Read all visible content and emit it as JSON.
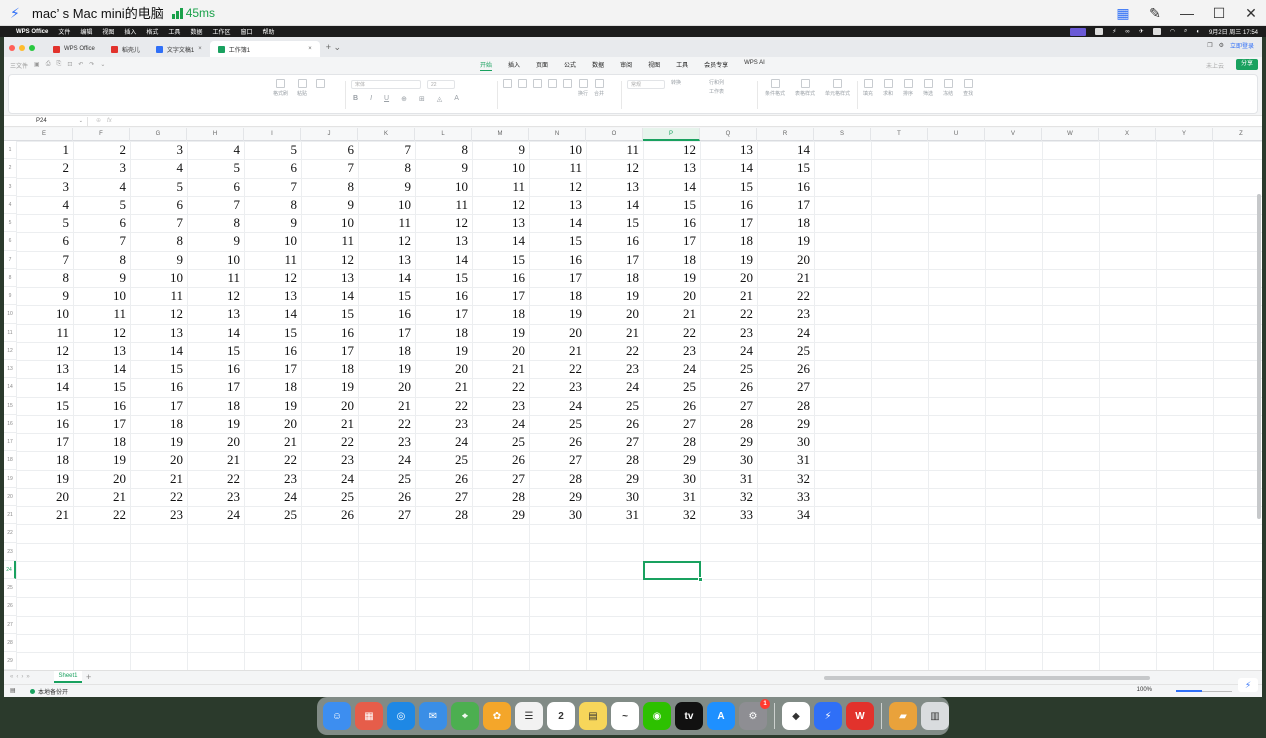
{
  "remote_desktop": {
    "title": "mac’ s Mac mini的电脑",
    "ping": "45ms"
  },
  "mac_menubar": {
    "app_name": "WPS Office",
    "items": [
      "文件",
      "编辑",
      "视图",
      "插入",
      "格式",
      "工具",
      "数据",
      "工作区",
      "窗口",
      "帮助"
    ],
    "clock": "9月2日 周三 17:54"
  },
  "wps": {
    "tabs": [
      {
        "label": "WPS Office",
        "color": "#e2322c"
      },
      {
        "label": "稻壳儿",
        "color": "#e2322c"
      },
      {
        "label": "文字文稿1",
        "color": "#2f6ff7"
      },
      {
        "label": "工作簿1",
        "color": "#19a15f",
        "active": true
      }
    ],
    "login_label": "立即登录",
    "quick_label": "三文件",
    "ribbon_tabs": [
      "开始",
      "插入",
      "页面",
      "公式",
      "数据",
      "审阅",
      "视图",
      "工具",
      "会员专享",
      "WPS AI"
    ],
    "active_ribbon_tab": "开始",
    "unsaved_label": "未上云",
    "share_label": "分享",
    "ribbon_items": {
      "clipboard": [
        "格式刷",
        "粘贴",
        ""
      ],
      "font_name": "宋体",
      "font_size": "22",
      "align": [
        "换行",
        "合并"
      ],
      "number_format": "常规",
      "tools": [
        "转换",
        "行和列",
        "工作表",
        "条件格式",
        "表格样式",
        "单元格样式",
        "填充",
        "求和",
        "排序",
        "筛选",
        "冻结",
        "查找"
      ]
    },
    "name_box": "P24",
    "fx_label": "fx"
  },
  "sheet": {
    "columns": [
      "E",
      "F",
      "G",
      "H",
      "I",
      "J",
      "K",
      "L",
      "M",
      "N",
      "O",
      "P",
      "Q",
      "R",
      "S",
      "T",
      "U",
      "V",
      "W",
      "X",
      "Y",
      "Z"
    ],
    "selected_column": "P",
    "row_numbers": [
      "1",
      "2",
      "3",
      "4",
      "5",
      "6",
      "7",
      "8",
      "9",
      "10",
      "11",
      "12",
      "13",
      "14",
      "15",
      "16",
      "17",
      "18",
      "19",
      "20",
      "21",
      "22",
      "23",
      "24",
      "25",
      "26",
      "27",
      "28",
      "29"
    ],
    "selected_row": "24",
    "data_rows": [
      [
        1,
        2,
        3,
        4,
        5,
        6,
        7,
        8,
        9,
        10,
        11,
        12,
        13,
        14
      ],
      [
        2,
        3,
        4,
        5,
        6,
        7,
        8,
        9,
        10,
        11,
        12,
        13,
        14,
        15
      ],
      [
        3,
        4,
        5,
        6,
        7,
        8,
        9,
        10,
        11,
        12,
        13,
        14,
        15,
        16
      ],
      [
        4,
        5,
        6,
        7,
        8,
        9,
        10,
        11,
        12,
        13,
        14,
        15,
        16,
        17
      ],
      [
        5,
        6,
        7,
        8,
        9,
        10,
        11,
        12,
        13,
        14,
        15,
        16,
        17,
        18
      ],
      [
        6,
        7,
        8,
        9,
        10,
        11,
        12,
        13,
        14,
        15,
        16,
        17,
        18,
        19
      ],
      [
        7,
        8,
        9,
        10,
        11,
        12,
        13,
        14,
        15,
        16,
        17,
        18,
        19,
        20
      ],
      [
        8,
        9,
        10,
        11,
        12,
        13,
        14,
        15,
        16,
        17,
        18,
        19,
        20,
        21
      ],
      [
        9,
        10,
        11,
        12,
        13,
        14,
        15,
        16,
        17,
        18,
        19,
        20,
        21,
        22
      ],
      [
        10,
        11,
        12,
        13,
        14,
        15,
        16,
        17,
        18,
        19,
        20,
        21,
        22,
        23
      ],
      [
        11,
        12,
        13,
        14,
        15,
        16,
        17,
        18,
        19,
        20,
        21,
        22,
        23,
        24
      ],
      [
        12,
        13,
        14,
        15,
        16,
        17,
        18,
        19,
        20,
        21,
        22,
        23,
        24,
        25
      ],
      [
        13,
        14,
        15,
        16,
        17,
        18,
        19,
        20,
        21,
        22,
        23,
        24,
        25,
        26
      ],
      [
        14,
        15,
        16,
        17,
        18,
        19,
        20,
        21,
        22,
        23,
        24,
        25,
        26,
        27
      ],
      [
        15,
        16,
        17,
        18,
        19,
        20,
        21,
        22,
        23,
        24,
        25,
        26,
        27,
        28
      ],
      [
        16,
        17,
        18,
        19,
        20,
        21,
        22,
        23,
        24,
        25,
        26,
        27,
        28,
        29
      ],
      [
        17,
        18,
        19,
        20,
        21,
        22,
        23,
        24,
        25,
        26,
        27,
        28,
        29,
        30
      ],
      [
        18,
        19,
        20,
        21,
        22,
        23,
        24,
        25,
        26,
        27,
        28,
        29,
        30,
        31
      ],
      [
        19,
        20,
        21,
        22,
        23,
        24,
        25,
        26,
        27,
        28,
        29,
        30,
        31,
        32
      ],
      [
        20,
        21,
        22,
        23,
        24,
        25,
        26,
        27,
        28,
        29,
        30,
        31,
        32,
        33
      ],
      [
        21,
        22,
        23,
        24,
        25,
        26,
        27,
        28,
        29,
        30,
        31,
        32,
        33,
        34
      ]
    ],
    "sheet_tab": "Sheet1",
    "backup_status": "本地备份开",
    "zoom": "100%"
  },
  "dock": {
    "apps": [
      {
        "name": "finder-icon",
        "color": "#3d8ef0",
        "glyph": "☺"
      },
      {
        "name": "launchpad-icon",
        "color": "#e65d4a",
        "glyph": "▦"
      },
      {
        "name": "safari-icon",
        "color": "#1e88e5",
        "glyph": "◎"
      },
      {
        "name": "mail-icon",
        "color": "#3a8ee6",
        "glyph": "✉"
      },
      {
        "name": "maps-icon",
        "color": "#4caf50",
        "glyph": "⌖"
      },
      {
        "name": "photos-icon",
        "color": "#f4a62a",
        "glyph": "✿"
      },
      {
        "name": "reminders-icon",
        "color": "#f2f2f2",
        "glyph": "☰"
      },
      {
        "name": "calendar-icon",
        "color": "#ffffff",
        "glyph": "2"
      },
      {
        "name": "notes-icon",
        "color": "#f7d65a",
        "glyph": "▤"
      },
      {
        "name": "freeform-icon",
        "color": "#ffffff",
        "glyph": "~"
      },
      {
        "name": "wechat-icon",
        "color": "#2dc100",
        "glyph": "◉"
      },
      {
        "name": "appletv-icon",
        "color": "#111111",
        "glyph": "tv"
      },
      {
        "name": "appstore-icon",
        "color": "#1e90ff",
        "glyph": "A"
      },
      {
        "name": "settings-icon",
        "color": "#8e8e93",
        "glyph": "⚙",
        "badge": "1"
      },
      {
        "name": "baidu-netdisk-icon",
        "color": "#ffffff",
        "glyph": "◆"
      },
      {
        "name": "todesk-icon",
        "color": "#2f6ff7",
        "glyph": "⚡"
      },
      {
        "name": "wps-icon",
        "color": "#e2322c",
        "glyph": "W"
      },
      {
        "name": "folder-icon",
        "color": "#e9a23b",
        "glyph": "▰"
      },
      {
        "name": "trash-icon",
        "color": "#d9dcde",
        "glyph": "▥"
      }
    ]
  }
}
